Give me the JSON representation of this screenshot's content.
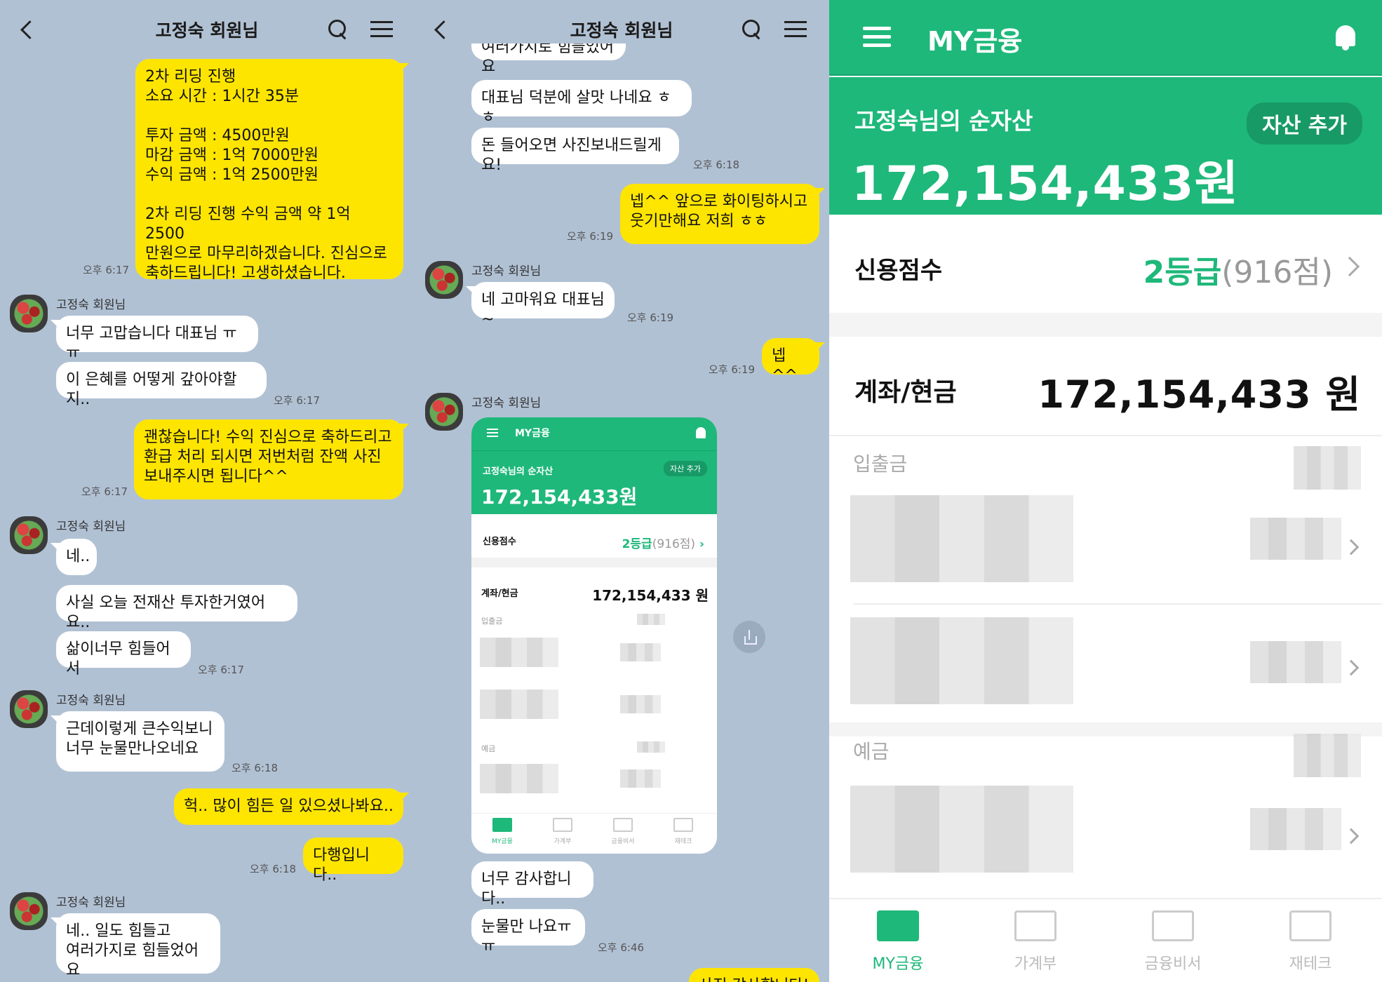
{
  "chat": {
    "title": "고정숙 회원님",
    "sender": "고정숙 회원님"
  },
  "panel1": {
    "messages": [
      {
        "text": "2차 리딩 진행\n소요 시간 : 1시간 35분\n\n투자 금액 : 4500만원\n마감 금액 : 1억 7000만원\n수익 금액 : 1억 2500만원\n\n2차 리딩 진행 수익 금액 약 1억 2500\n만원으로 마무리하겠습니다. 진심으로\n축하드립니다! 고생하셨습니다.",
        "time": "오후 6:17"
      },
      {
        "text": "너무 고맙습니다 대표님 ㅠㅠ"
      },
      {
        "text": "이 은혜를 어떻게 갚아야할지..",
        "time": "오후 6:17"
      },
      {
        "text": "괜찮습니다! 수익 진심으로 축하드리고\n환급 처리 되시면 저번처럼 잔액 사진\n보내주시면 됩니다^^",
        "time": "오후 6:17"
      },
      {
        "text": "네.."
      },
      {
        "text": "사실 오늘 전재산 투자한거였어요.."
      },
      {
        "text": "삶이너무 힘들어서",
        "time": "오후 6:17"
      },
      {
        "text": "근데이렇게 큰수익보니\n너무 눈물만나오네요",
        "time": "오후 6:18"
      },
      {
        "text": "헉.. 많이 힘든 일 있으셨나봐요.."
      },
      {
        "text": "다행입니다..",
        "time": "오후 6:18"
      },
      {
        "text": "네.. 일도 힘들고\n여러가지로 힘들었어요"
      }
    ]
  },
  "panel2": {
    "messages": [
      {
        "text": "여러가지로 힘들었어요"
      },
      {
        "text": "대표님 덕분에 살맛 나네요 ㅎㅎ"
      },
      {
        "text": "돈 들어오면 사진보내드릴게요!",
        "time": "오후 6:18"
      },
      {
        "text": "넵^^ 앞으로 화이팅하시고\n웃기만해요 저희 ㅎㅎ",
        "time": "오후 6:19"
      },
      {
        "text": "네 고마워요 대표님~",
        "time": "오후 6:19"
      },
      {
        "text": "넵^^",
        "time": "오후 6:19"
      },
      {
        "text": "너무 감사합니다.."
      },
      {
        "text": "눈물만 나요ㅠㅠ",
        "time": "오후 6:46"
      },
      {
        "text": "사진 감사합니다!"
      }
    ]
  },
  "app": {
    "title": "MY금융",
    "net_label": "고정숙님의 순자산",
    "add_button": "자산 추가",
    "total": "172,154,433원",
    "credit_label": "신용점수",
    "credit_grade": "2등급",
    "credit_points": "(916점)",
    "account_label": "계좌/현금",
    "account_value": "172,154,433 원",
    "section_deposits_withdrawals": "입출금",
    "section_savings": "예금",
    "nav": [
      "MY금융",
      "가계부",
      "금융비서",
      "재테크"
    ]
  },
  "colors": {
    "chat_bg": "#b1c1d4",
    "my_bubble": "#fee500",
    "their_bubble": "#ffffff",
    "app_green": "#1eb87a"
  }
}
